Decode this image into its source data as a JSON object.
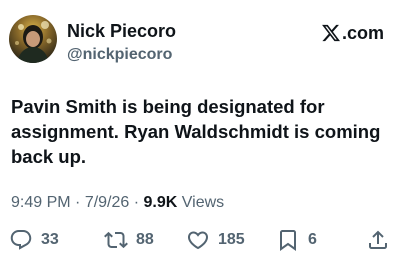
{
  "author": {
    "display_name": "Nick Piecoro",
    "handle": "@nickpiecoro",
    "avatar_icon": "profile-photo"
  },
  "brand": {
    "icon": "x-logo-icon",
    "text": ".com"
  },
  "tweet": {
    "text": "Pavin Smith is being designated for assignment. Ryan Waldschmidt is coming back up."
  },
  "meta": {
    "time": "9:49 PM",
    "separator1": " · ",
    "date": "7/9/26",
    "separator2": " · ",
    "views_count": "9.9K",
    "views_label": " Views"
  },
  "actions": {
    "replies": {
      "icon": "reply-icon",
      "count": "33"
    },
    "reposts": {
      "icon": "repost-icon",
      "count": "88"
    },
    "likes": {
      "icon": "heart-icon",
      "count": "185"
    },
    "bookmarks": {
      "icon": "bookmark-icon",
      "count": "6"
    },
    "share": {
      "icon": "share-icon"
    }
  },
  "colors": {
    "text_primary": "#0f1419",
    "text_secondary": "#536471",
    "background": "#ffffff"
  }
}
